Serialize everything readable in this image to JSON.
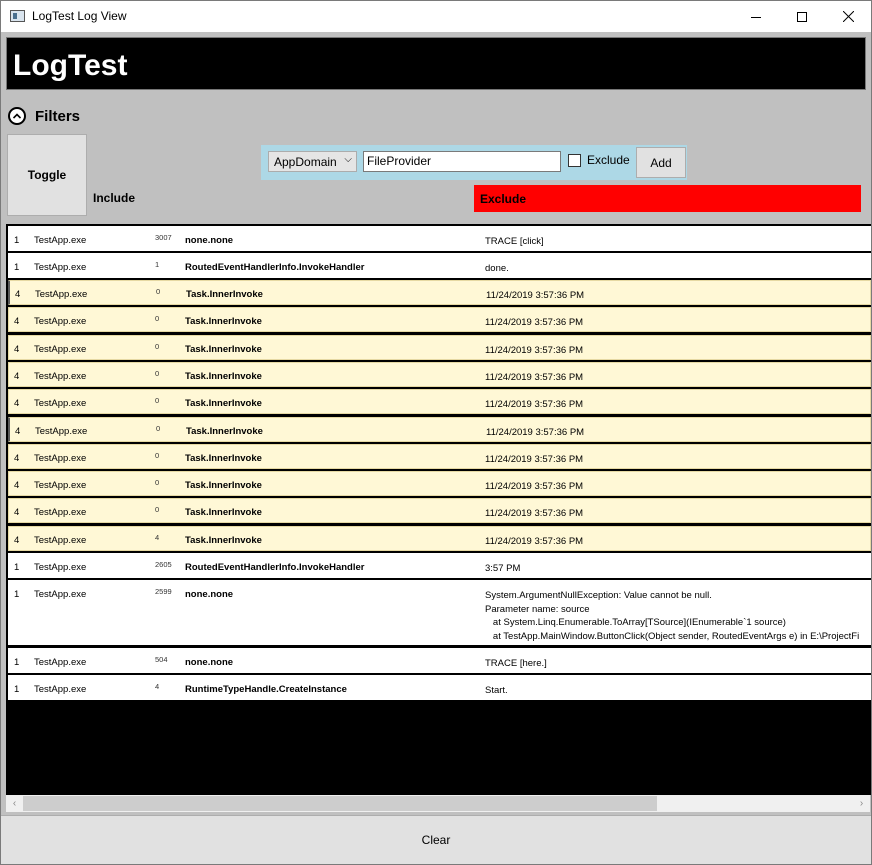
{
  "window": {
    "title": "LogTest Log View",
    "controls": {
      "minimize": "—",
      "maximize": "☐",
      "close": "✕"
    }
  },
  "header": {
    "title": "LogTest"
  },
  "filters": {
    "title": "Filters",
    "toggle_label": "Toggle",
    "include_label": "Include",
    "exclude_label": "Exclude",
    "field_select": "AppDomain",
    "value_input": "FileProvider",
    "exclude_checkbox_label": "Exclude",
    "exclude_checked": false,
    "add_label": "Add"
  },
  "rows": [
    {
      "level": "1",
      "process": "TestApp.exe",
      "id": "3007",
      "source": "none.none",
      "message": "TRACE [click]"
    },
    {
      "level": "1",
      "process": "TestApp.exe",
      "id": "1",
      "source": "RoutedEventHandlerInfo.InvokeHandler",
      "message": "done."
    },
    {
      "level": "4",
      "process": "TestApp.exe",
      "id": "0",
      "source": "Task.InnerInvoke",
      "message": "11/24/2019 3:57:36 PM"
    },
    {
      "level": "4",
      "process": "TestApp.exe",
      "id": "0",
      "source": "Task.InnerInvoke",
      "message": "11/24/2019 3:57:36 PM"
    },
    {
      "level": "4",
      "process": "TestApp.exe",
      "id": "0",
      "source": "Task.InnerInvoke",
      "message": "11/24/2019 3:57:36 PM"
    },
    {
      "level": "4",
      "process": "TestApp.exe",
      "id": "0",
      "source": "Task.InnerInvoke",
      "message": "11/24/2019 3:57:36 PM"
    },
    {
      "level": "4",
      "process": "TestApp.exe",
      "id": "0",
      "source": "Task.InnerInvoke",
      "message": "11/24/2019 3:57:36 PM"
    },
    {
      "level": "4",
      "process": "TestApp.exe",
      "id": "0",
      "source": "Task.InnerInvoke",
      "message": "11/24/2019 3:57:36 PM"
    },
    {
      "level": "4",
      "process": "TestApp.exe",
      "id": "0",
      "source": "Task.InnerInvoke",
      "message": "11/24/2019 3:57:36 PM"
    },
    {
      "level": "4",
      "process": "TestApp.exe",
      "id": "0",
      "source": "Task.InnerInvoke",
      "message": "11/24/2019 3:57:36 PM"
    },
    {
      "level": "4",
      "process": "TestApp.exe",
      "id": "0",
      "source": "Task.InnerInvoke",
      "message": "11/24/2019 3:57:36 PM"
    },
    {
      "level": "4",
      "process": "TestApp.exe",
      "id": "4",
      "source": "Task.InnerInvoke",
      "message": "11/24/2019 3:57:36 PM"
    },
    {
      "level": "1",
      "process": "TestApp.exe",
      "id": "2605",
      "source": "RoutedEventHandlerInfo.InvokeHandler",
      "message": "3:57 PM"
    },
    {
      "level": "1",
      "process": "TestApp.exe",
      "id": "2599",
      "source": "none.none",
      "message": "System.ArgumentNullException: Value cannot be null.\nParameter name: source\n   at System.Linq.Enumerable.ToArray[TSource](IEnumerable`1 source)\n   at TestApp.MainWindow.ButtonClick(Object sender, RoutedEventArgs e) in E:\\ProjectFi"
    },
    {
      "level": "1",
      "process": "TestApp.exe",
      "id": "504",
      "source": "none.none",
      "message": "TRACE [here.]"
    },
    {
      "level": "1",
      "process": "TestApp.exe",
      "id": "4",
      "source": "RuntimeTypeHandle.CreateInstance",
      "message": "Start."
    }
  ],
  "colors": {
    "warning_row": "#fff8d6",
    "exclude_bar": "#ff0000",
    "filter_bar": "#add8e6",
    "header_bg": "#000000"
  },
  "clear_label": "Clear"
}
